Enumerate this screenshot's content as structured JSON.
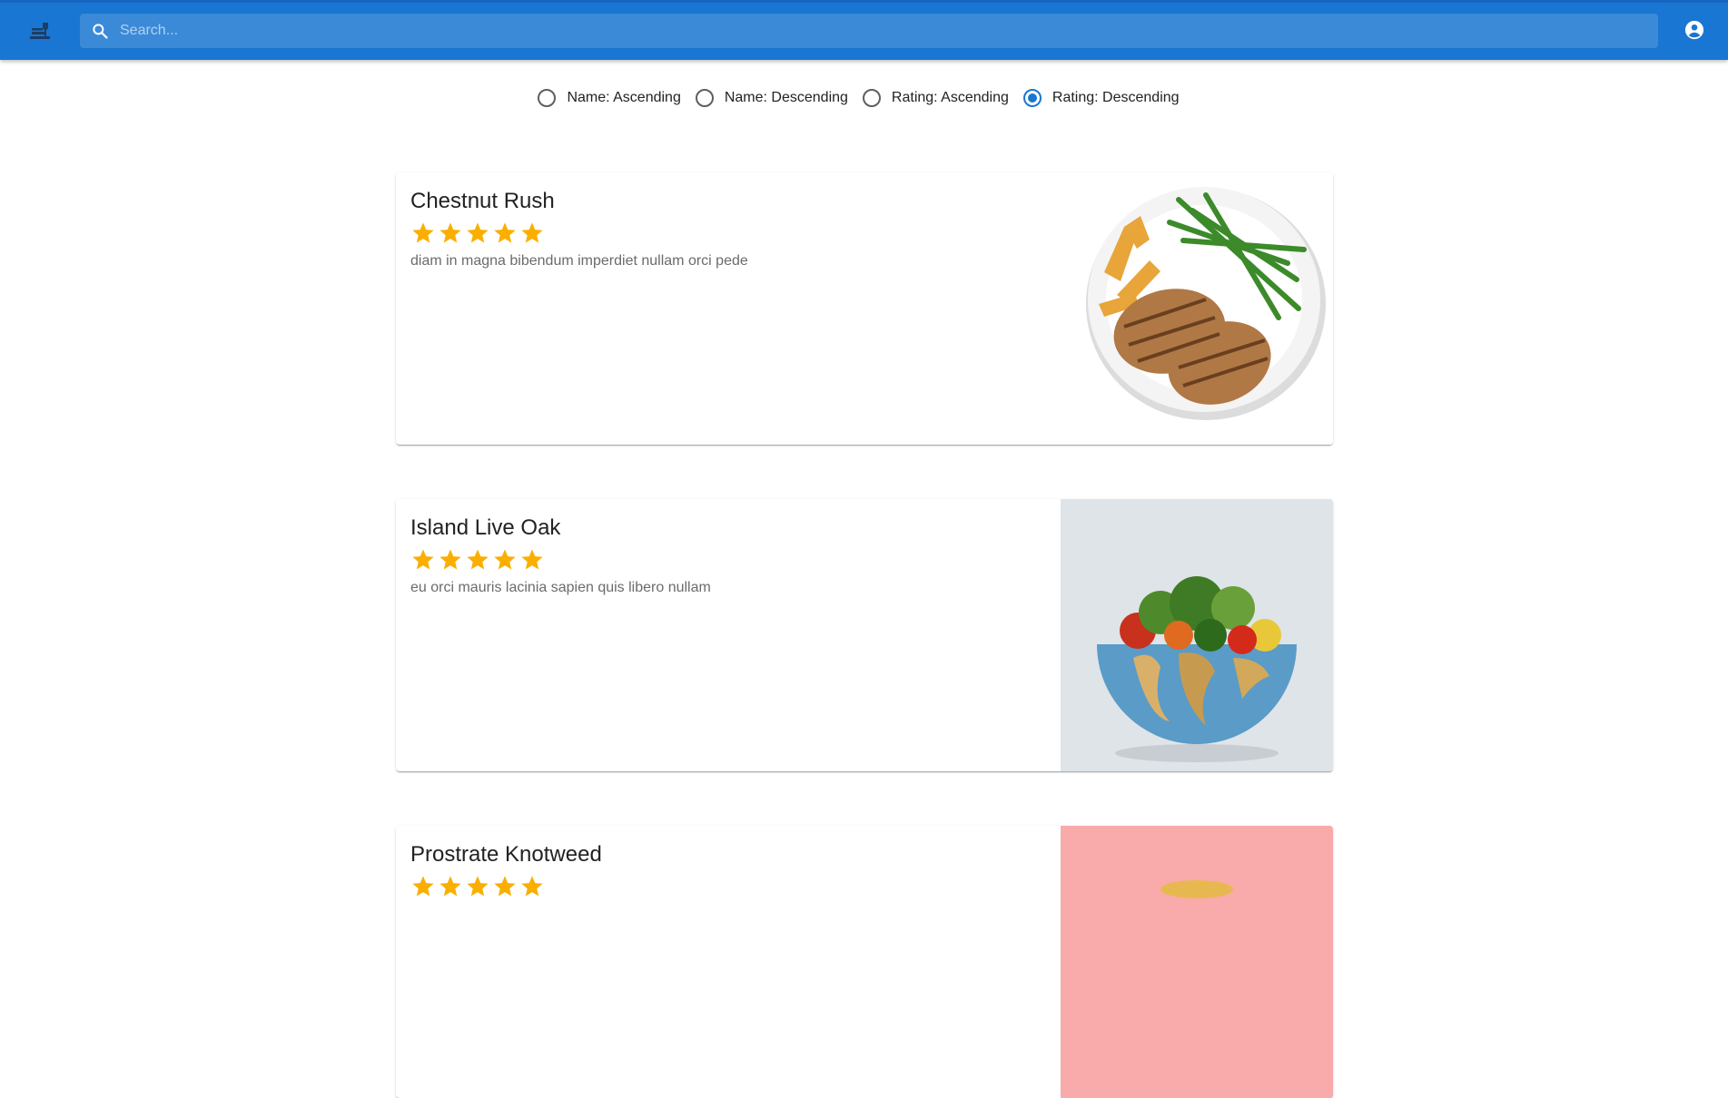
{
  "search": {
    "placeholder": "Search..."
  },
  "sort": {
    "options": [
      {
        "label": "Name: Ascending",
        "checked": false
      },
      {
        "label": "Name: Descending",
        "checked": false
      },
      {
        "label": "Rating: Ascending",
        "checked": false
      },
      {
        "label": "Rating: Descending",
        "checked": true
      }
    ]
  },
  "recipes": [
    {
      "title": "Chestnut Rush",
      "rating": 5,
      "rating_max": 5,
      "description": "diam in magna bibendum imperdiet nullam orci pede"
    },
    {
      "title": "Island Live Oak",
      "rating": 5,
      "rating_max": 5,
      "description": "eu orci mauris lacinia sapien quis libero nullam"
    },
    {
      "title": "Prostrate Knotweed",
      "rating": 5,
      "rating_max": 5,
      "description": ""
    }
  ],
  "colors": {
    "primary": "#1976d2",
    "star": "#faaf00",
    "card_image_3_bg": "#f9aaaa"
  },
  "icons": {
    "logo": "restaurant-menu-icon",
    "search": "search-icon",
    "account": "account-circle-icon",
    "star": "star-icon"
  }
}
